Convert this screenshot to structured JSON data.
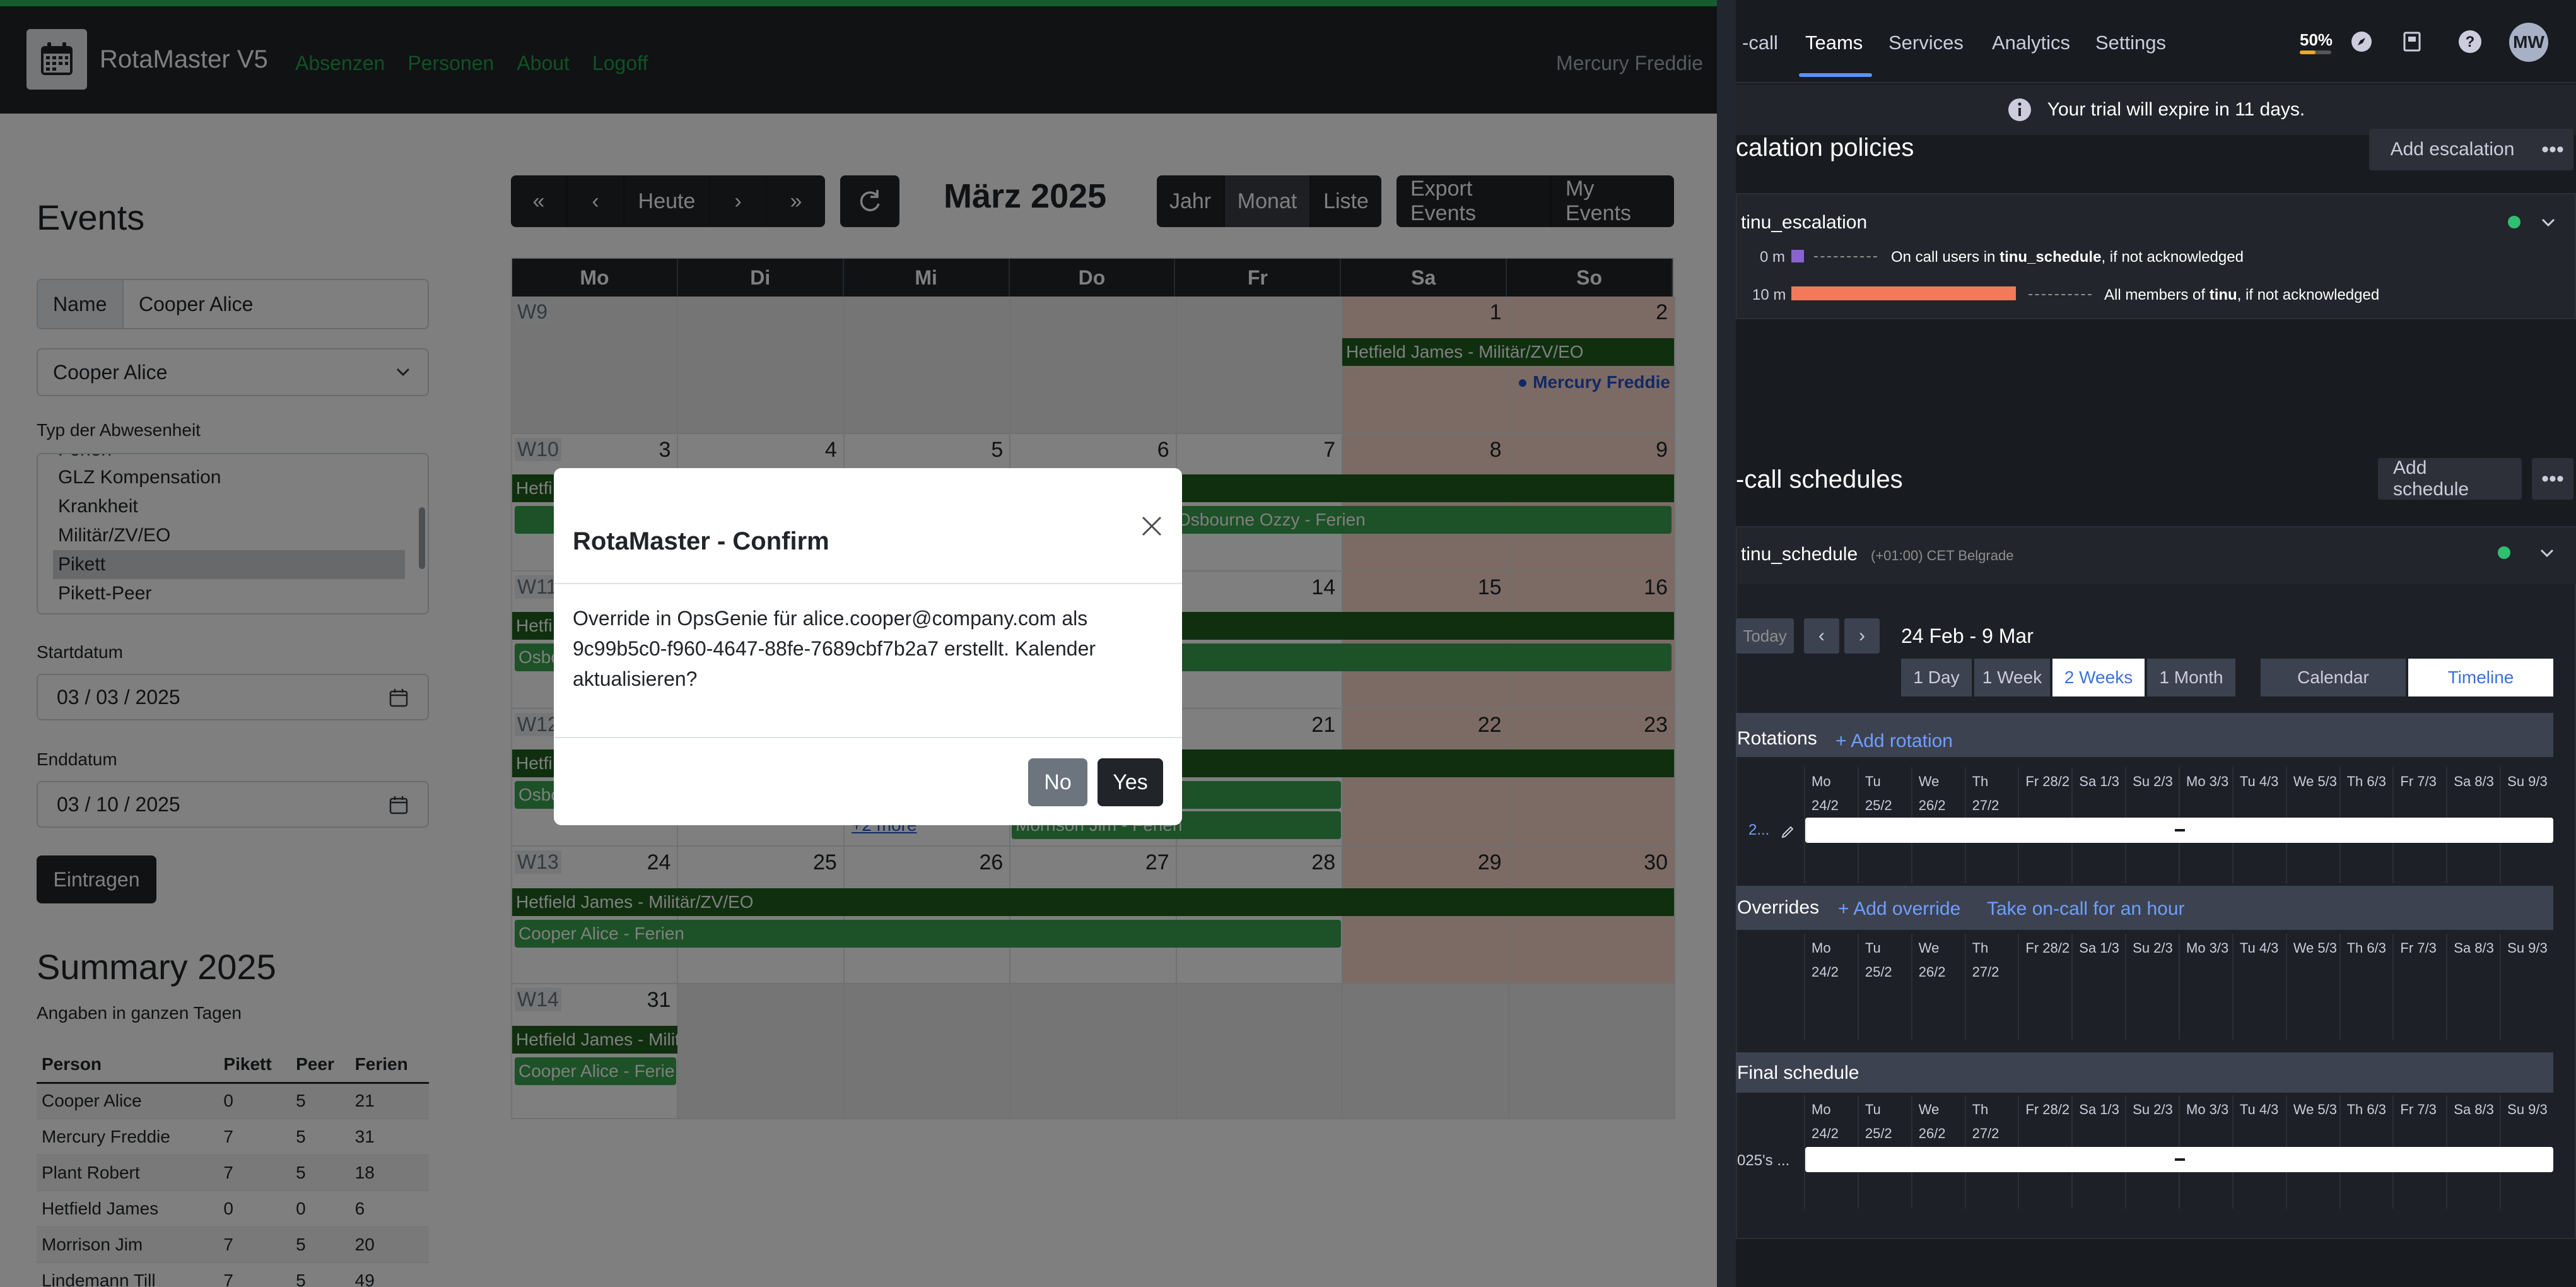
{
  "rota": {
    "brand": "RotaMaster V5",
    "nav": [
      "Absenzen",
      "Personen",
      "About",
      "Logoff"
    ],
    "user": "Mercury Freddie",
    "events_title": "Events",
    "name_label": "Name",
    "name_value": "Cooper Alice",
    "person_select": "Cooper Alice",
    "typ_label": "Typ der Abwesenheit",
    "typ_options": [
      "Ferien",
      "GLZ Kompensation",
      "Krankheit",
      "Militär/ZV/EO",
      "Pikett",
      "Pikett-Peer"
    ],
    "typ_selected": "Pikett",
    "start_label": "Startdatum",
    "start_value": "03 / 03 / 2025",
    "end_label": "Enddatum",
    "end_value": "03 / 10 / 2025",
    "submit": "Eintragen",
    "summary_title": "Summary 2025",
    "summary_sub": "Angaben in ganzen Tagen",
    "summary_head": [
      "Person",
      "Pikett",
      "Peer",
      "Ferien"
    ],
    "summary_rows": [
      [
        "Cooper Alice",
        "0",
        "5",
        "21"
      ],
      [
        "Mercury Freddie",
        "7",
        "5",
        "31"
      ],
      [
        "Plant Robert",
        "7",
        "5",
        "18"
      ],
      [
        "Hetfield James",
        "0",
        "0",
        "6"
      ],
      [
        "Morrison Jim",
        "7",
        "5",
        "20"
      ],
      [
        "Lindemann Till",
        "7",
        "5",
        "49"
      ]
    ],
    "toolbar": {
      "first": "«",
      "prev": "‹",
      "today": "Heute",
      "next": "›",
      "last": "»",
      "refresh_icon": "refresh-icon",
      "views": [
        "Jahr",
        "Monat",
        "Liste"
      ],
      "active_view": "Monat",
      "export": "Export Events",
      "my_events": "My Events"
    },
    "cal_title": "März 2025",
    "weekdays": [
      "Mo",
      "Di",
      "Mi",
      "Do",
      "Fr",
      "Sa",
      "So"
    ],
    "weeks": [
      {
        "wk": "W9",
        "days": [
          "",
          "",
          "",
          "",
          "",
          "1",
          "2"
        ]
      },
      {
        "wk": "W10",
        "days": [
          "3",
          "4",
          "5",
          "6",
          "7",
          "8",
          "9"
        ]
      },
      {
        "wk": "W11",
        "days": [
          "",
          "",
          "",
          "",
          "14",
          "15",
          "16"
        ]
      },
      {
        "wk": "W12",
        "days": [
          "",
          "",
          "",
          "",
          "21",
          "22",
          "23"
        ]
      },
      {
        "wk": "W13",
        "days": [
          "24",
          "25",
          "26",
          "27",
          "28",
          "29",
          "30"
        ]
      },
      {
        "wk": "W14",
        "days": [
          "31",
          "",
          "",
          "",
          "",
          "",
          ""
        ]
      }
    ],
    "events": {
      "w9_mil": "Hetfield James - Militär/ZV/EO",
      "w9_dot": "● Mercury Freddie",
      "w10_mil": "Hetfi",
      "w10_fer": "Osbourne Ozzy - Ferien",
      "w11_mil": "Hetfi",
      "w11_fer": "Osbo",
      "w12_mil": "Hetfi",
      "w12_fer": "Osbo",
      "w12_more": "+2 more",
      "w12_morrison": "Morrison Jim - Ferien",
      "w13_mil": "Hetfield James - Militär/ZV/EO",
      "w13_fer": "Cooper Alice - Ferien",
      "w14_mil": "Hetfield James - Milit",
      "w14_fer": "Cooper Alice - Ferie"
    },
    "modal": {
      "title": "RotaMaster - Confirm",
      "body": "Override in OpsGenie für alice.cooper@company.com als 9c99b5c0-f960-4647-88fe-7689cbf7b2a7 erstellt. Kalender aktualisieren?",
      "no": "No",
      "yes": "Yes"
    }
  },
  "ops": {
    "nav": [
      "-call",
      "Teams",
      "Services",
      "Analytics",
      "Settings"
    ],
    "active_nav": "Teams",
    "usage_pct": "50%",
    "usage_fraction": 0.5,
    "avatar": "MW",
    "trial": "Your trial will expire in 11 days.",
    "escalation_title": "calation policies",
    "add_escalation": "Add escalation",
    "more": "•••",
    "policy_name": "tinu_escalation",
    "rule1_time": "0 m",
    "rule1_text_a": "On call users in ",
    "rule1_bold": "tinu_schedule",
    "rule1_text_b": ", if not acknowledged",
    "rule2_time": "10 m",
    "rule2_text_a": "All members of ",
    "rule2_bold": "tinu",
    "rule2_text_b": ", if not acknowledged",
    "schedules_title": "-call schedules",
    "add_schedule": "Add schedule",
    "schedule_name": "tinu_schedule",
    "schedule_tz": "(+01:00) CET Belgrade",
    "today": "Today",
    "prev": "‹",
    "next": "›",
    "range": "24 Feb - 9 Mar",
    "ranges": [
      "1 Day",
      "1 Week",
      "2 Weeks",
      "1 Month"
    ],
    "active_range": "2 Weeks",
    "modes": [
      "Calendar",
      "Timeline"
    ],
    "active_mode": "Timeline",
    "rotations": "Rotations",
    "add_rotation": "+ Add rotation",
    "rotation_label": "2...",
    "overrides": "Overrides",
    "add_override": "+ Add override",
    "take_oncall": "Take on-call for an hour",
    "final_schedule": "Final schedule",
    "final_label": "025's ...",
    "days": [
      [
        "Mo",
        "24/2"
      ],
      [
        "Tu 25/2",
        ""
      ],
      [
        "We",
        "26/2"
      ],
      [
        "Th 27/2",
        ""
      ],
      [
        "Fr 28/2",
        ""
      ],
      [
        "Sa 1/3",
        ""
      ],
      [
        "Su 2/3",
        ""
      ],
      [
        "Mo 3/3",
        ""
      ],
      [
        "Tu 4/3",
        ""
      ],
      [
        "We 5/3",
        ""
      ],
      [
        "Th 6/3",
        ""
      ],
      [
        "Fr 7/3",
        ""
      ],
      [
        "Sa 8/3",
        ""
      ],
      [
        "Su 9/3",
        ""
      ]
    ],
    "colors": {
      "accent": "#5794f2",
      "green": "#2fbf71",
      "orange": "#f07a5a",
      "purple": "#8a63d2"
    }
  }
}
